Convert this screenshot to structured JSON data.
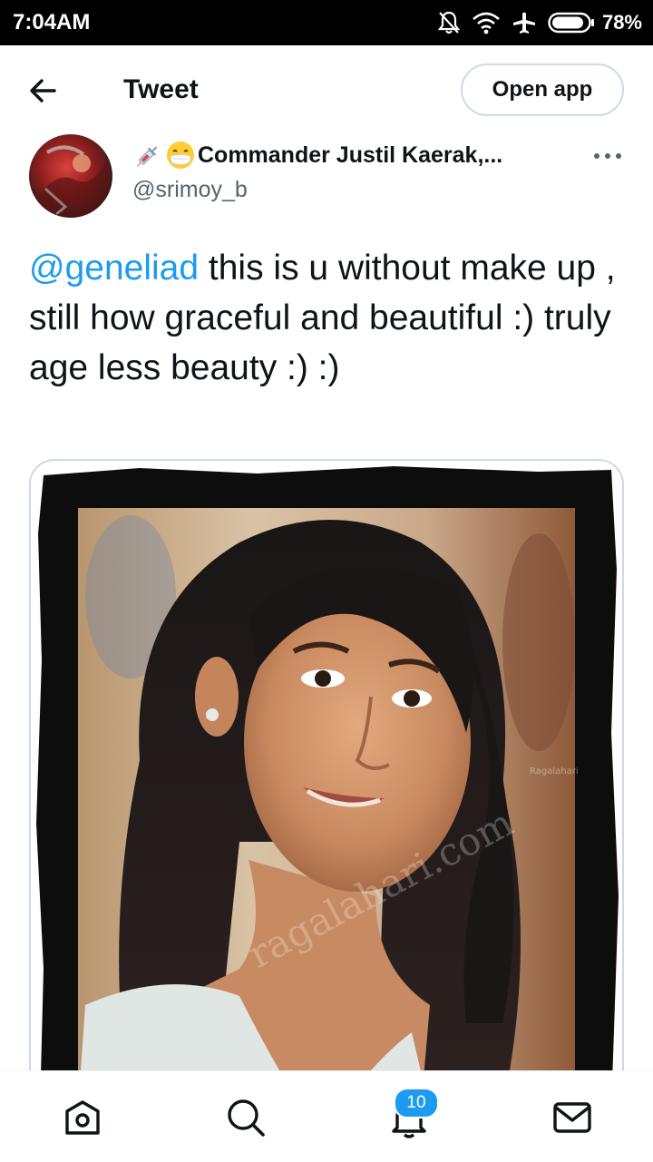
{
  "status_bar": {
    "time": "7:04AM",
    "battery": "78%"
  },
  "header": {
    "title": "Tweet",
    "open_app_label": "Open app"
  },
  "tweet": {
    "author_name": "Commander Justil Kaerak,...",
    "author_handle": "@srimoy_b",
    "mention": "@geneliad",
    "text": " this is u without make up , still how graceful and beautiful :) truly age less beauty :) :)",
    "media_watermark": "ragalahari.com",
    "media_small_watermark": "Ragalahari"
  },
  "bottom_nav": {
    "items": [
      "home-icon",
      "search-icon",
      "notifications-icon",
      "messages-icon"
    ],
    "notifications_count": "10"
  },
  "colors": {
    "accent": "#1d9bf0",
    "text": "#0f1419",
    "secondary": "#536471",
    "border": "#cfd9de"
  }
}
